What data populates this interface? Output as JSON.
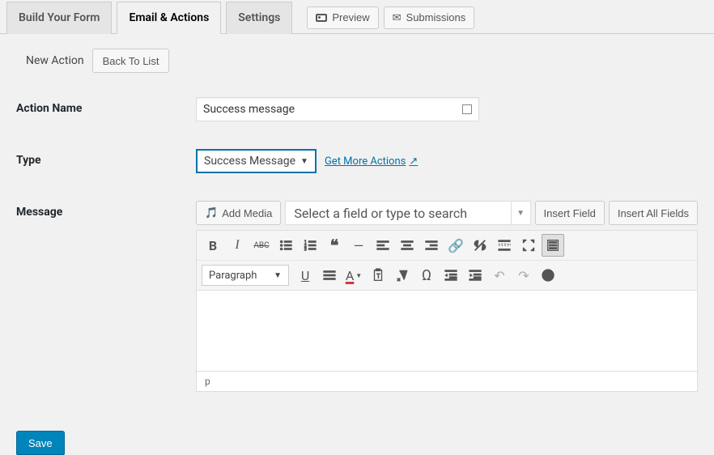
{
  "tabs": {
    "build": "Build Your Form",
    "email": "Email & Actions",
    "settings": "Settings",
    "preview": "Preview",
    "submissions": "Submissions"
  },
  "newAction": {
    "label": "New Action",
    "backBtn": "Back To List"
  },
  "fields": {
    "actionName": {
      "label": "Action Name",
      "value": "Success message"
    },
    "type": {
      "label": "Type",
      "value": "Success Message",
      "moreLink": "Get More Actions"
    },
    "message": {
      "label": "Message"
    }
  },
  "editor": {
    "addMedia": "Add Media",
    "fieldSelect": "Select a field or type to search",
    "insertField": "Insert Field",
    "insertAllFields": "Insert All Fields",
    "paragraph": "Paragraph",
    "status": "p"
  },
  "save": "Save"
}
